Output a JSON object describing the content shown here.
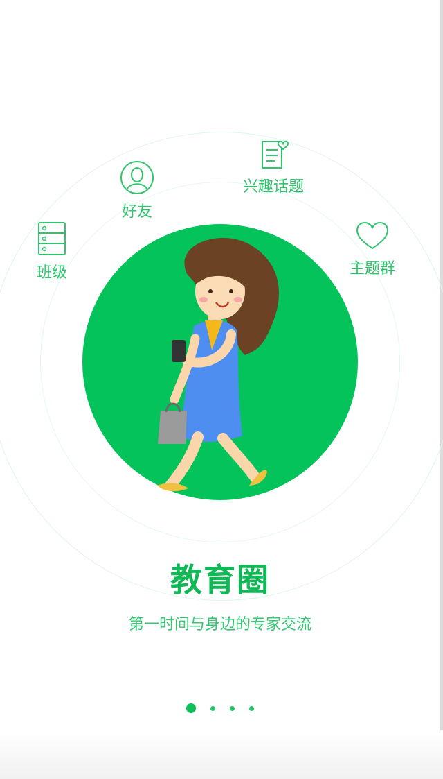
{
  "features": [
    {
      "icon": "class-cabinet-icon",
      "label": "班级"
    },
    {
      "icon": "friend-avatar-icon",
      "label": "好友"
    },
    {
      "icon": "topic-note-heart-icon",
      "label": "兴趣话题"
    },
    {
      "icon": "heart-icon",
      "label": "主题群"
    }
  ],
  "title": "教育圈",
  "subtitle": "第一时间与身边的专家交流",
  "pager": {
    "pages": 4,
    "current_index": 0
  },
  "colors": {
    "brand_green": "#04c35b",
    "text_green": "#10b955"
  }
}
